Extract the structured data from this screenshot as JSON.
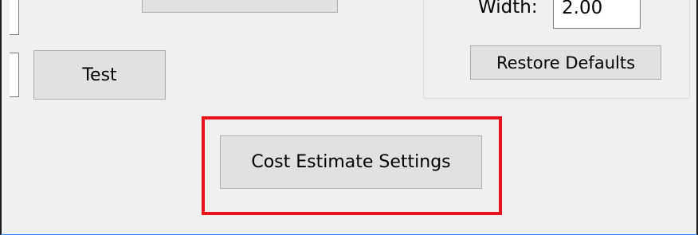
{
  "buttons": {
    "top_partial_label": "",
    "test_label": "Test",
    "restore_defaults_label": "Restore Defaults",
    "cost_estimate_settings_label": "Cost Estimate Settings"
  },
  "fields": {
    "width_label": "Width:",
    "width_value": "2.00"
  },
  "colors": {
    "highlight": "#e8131b",
    "button_face": "#e1e1e1",
    "window_bg": "#f0f0f0"
  }
}
